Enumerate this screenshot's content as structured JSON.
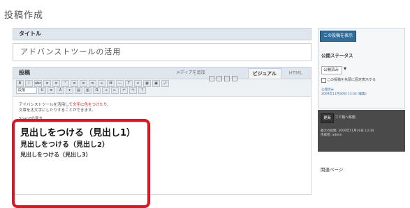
{
  "page": {
    "title": "投稿作成"
  },
  "post": {
    "title_label": "タイトル",
    "title_value": "アドバンストツールの活用",
    "body_label": "投稿",
    "media_label": "メディアを追加",
    "tab_visual": "ビジュアル",
    "tab_html": "HTML",
    "toolbar": {
      "row1": [
        "B",
        "I",
        "abc",
        "≡",
        "≡",
        "“",
        "≡",
        "≡",
        "≡",
        "∞",
        "⌘",
        "—",
        "T",
        "▾",
        "▦",
        "▣",
        "⤢"
      ],
      "format_select": "段落",
      "row2": [
        "U",
        "≡",
        "A",
        "▾",
        "▤",
        "▥",
        "Ω",
        "⇥",
        "⇤",
        "↶",
        "↷",
        "?"
      ]
    },
    "content": {
      "line1_pre": "アドバンストツールを活用して",
      "line1_red": "文字に色をつけたり",
      "line1_post": "、",
      "line2": "文章を太文字にしたりすることができます。",
      "line3": "Snap2の見方",
      "heading1": "見出しをつける（見出し1）",
      "heading2": "見出しをつける（見出し2）",
      "heading3": "見出しをつける（見出し3）"
    }
  },
  "sidebar": {
    "preview_button": "この投稿を表示",
    "status_label": "公開ステータス",
    "status_select": "公開済み",
    "checkbox_label": "この投稿を先頭に固定表示する",
    "meta_line1": "公開済み",
    "meta_line2": "2009年11月30日 13:34 (編集)",
    "update_button": "更新",
    "trash_link": "ゴミ箱へ移動",
    "dark_info1": "最大の投稿: 2009年11月30日 13:34",
    "dark_info2": "作成者: admin",
    "related_label": "関連ページ"
  },
  "colors": {
    "accent": "#2f6d9c",
    "highlight_box": "#e0141e",
    "red_text": "#cc2222"
  }
}
